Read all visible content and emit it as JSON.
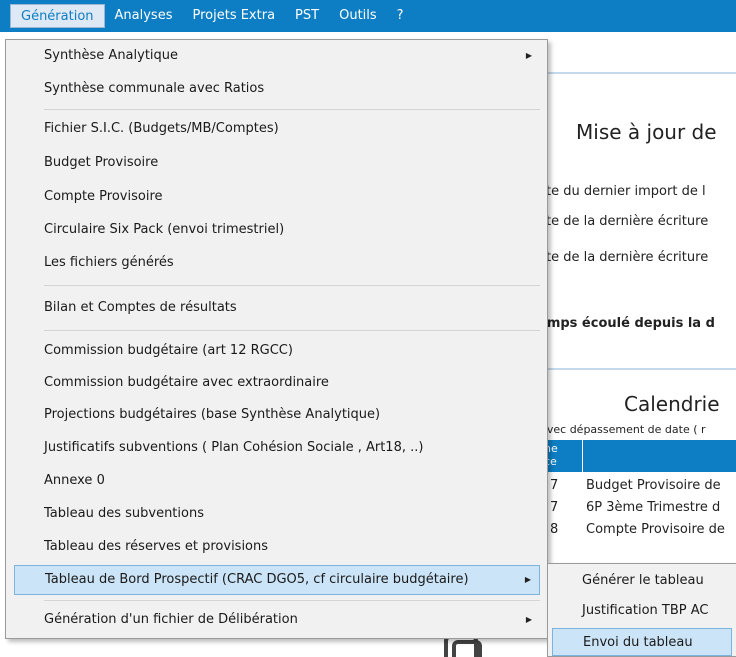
{
  "menubar": {
    "items": [
      "Génération",
      "Analyses",
      "Projets Extra",
      "PST",
      "Outils",
      "?"
    ]
  },
  "background": {
    "panel1": {
      "title": "Mise à jour de",
      "lines": [
        "ate du dernier import de l",
        "ate de la dernière écriture",
        "ate de la dernière écriture"
      ],
      "bold_line": "emps écoulé depuis la d"
    },
    "panel2": {
      "title": "Calendrie",
      "note": "Avec dépassement de date ( r",
      "header": "ne\nce",
      "rows": [
        {
          "c1": "7",
          "c2": "Budget Provisoire de"
        },
        {
          "c1": "7",
          "c2": "6P 3ème Trimestre d"
        },
        {
          "c1": "8",
          "c2": "Compte Provisoire de"
        }
      ]
    }
  },
  "dropdown": {
    "items": [
      {
        "label": "Synthèse Analytique",
        "submenu": true
      },
      {
        "label": "Synthèse communale avec Ratios",
        "submenu": false
      },
      {
        "label": "Fichier S.I.C. (Budgets/MB/Comptes)",
        "submenu": false
      },
      {
        "label": "Budget Provisoire",
        "submenu": false
      },
      {
        "label": "Compte Provisoire",
        "submenu": false
      },
      {
        "label": "Circulaire Six Pack (envoi trimestriel)",
        "submenu": false
      },
      {
        "label": "Les fichiers générés",
        "submenu": false
      },
      {
        "label": "Bilan et Comptes de résultats",
        "submenu": false
      },
      {
        "label": "Commission budgétaire (art 12 RGCC)",
        "submenu": false
      },
      {
        "label": "Commission budgétaire avec extraordinaire",
        "submenu": false
      },
      {
        "label": "Projections budgétaires (base Synthèse Analytique)",
        "submenu": false
      },
      {
        "label": "Justificatifs subventions ( Plan Cohésion Sociale , Art18, ..)",
        "submenu": false
      },
      {
        "label": "Annexe 0",
        "submenu": false
      },
      {
        "label": "Tableau des subventions",
        "submenu": false
      },
      {
        "label": "Tableau des réserves et provisions",
        "submenu": false
      },
      {
        "label": "Tableau de Bord Prospectif (CRAC DGO5, cf circulaire budgétaire)",
        "submenu": true,
        "highlighted": true
      },
      {
        "label": "Génération d'un fichier de Délibération",
        "submenu": true
      }
    ]
  },
  "submenu": {
    "items": [
      {
        "label": "Générer le tableau"
      },
      {
        "label": "Justification TBP AC"
      },
      {
        "label": "Envoi du tableau",
        "highlighted": true
      }
    ]
  },
  "colors": {
    "accent": "#0d7ec3",
    "highlight": "#cce4f7",
    "menu_bg": "#f1f1f1"
  }
}
